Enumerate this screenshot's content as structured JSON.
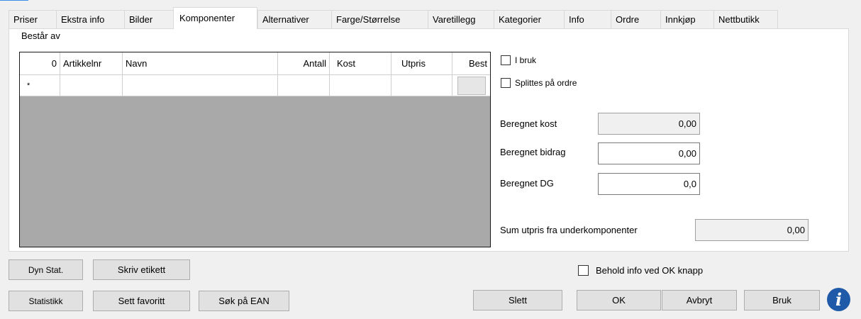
{
  "tabs": [
    {
      "label": "Priser"
    },
    {
      "label": "Ekstra info"
    },
    {
      "label": "Bilder"
    },
    {
      "label": "Komponenter",
      "active": true
    },
    {
      "label": "Alternativer"
    },
    {
      "label": "Farge/Størrelse"
    },
    {
      "label": "Varetillegg"
    },
    {
      "label": "Kategorier"
    },
    {
      "label": "Info"
    },
    {
      "label": "Ordre"
    },
    {
      "label": "Innkjøp"
    },
    {
      "label": "Nettbutikk"
    }
  ],
  "components": {
    "group_label": "Består av",
    "columns": [
      "0",
      "Artikkelnr",
      "Navn",
      "Antall",
      "Kost",
      "Utpris",
      "Best"
    ],
    "new_row_marker": "*"
  },
  "options": {
    "in_use_label": "I bruk",
    "split_on_order_label": "Splittes på ordre"
  },
  "calculated": {
    "cost_label": "Beregnet kost",
    "cost_value": "0,00",
    "contribution_label": "Beregnet bidrag",
    "contribution_value": "0,00",
    "dg_label": "Beregnet DG",
    "dg_value": "0,0",
    "sum_label": "Sum utpris fra underkomponenter",
    "sum_value": "0,00"
  },
  "footer": {
    "dyn_stat": "Dyn Stat.",
    "print_label": "Skriv etikett",
    "statistics": "Statistikk",
    "set_favorite": "Sett favoritt",
    "search_ean": "Søk på EAN",
    "keep_info_label": "Behold info ved OK knapp",
    "delete": "Slett",
    "ok": "OK",
    "cancel": "Avbryt",
    "apply": "Bruk",
    "info_glyph": "i"
  }
}
